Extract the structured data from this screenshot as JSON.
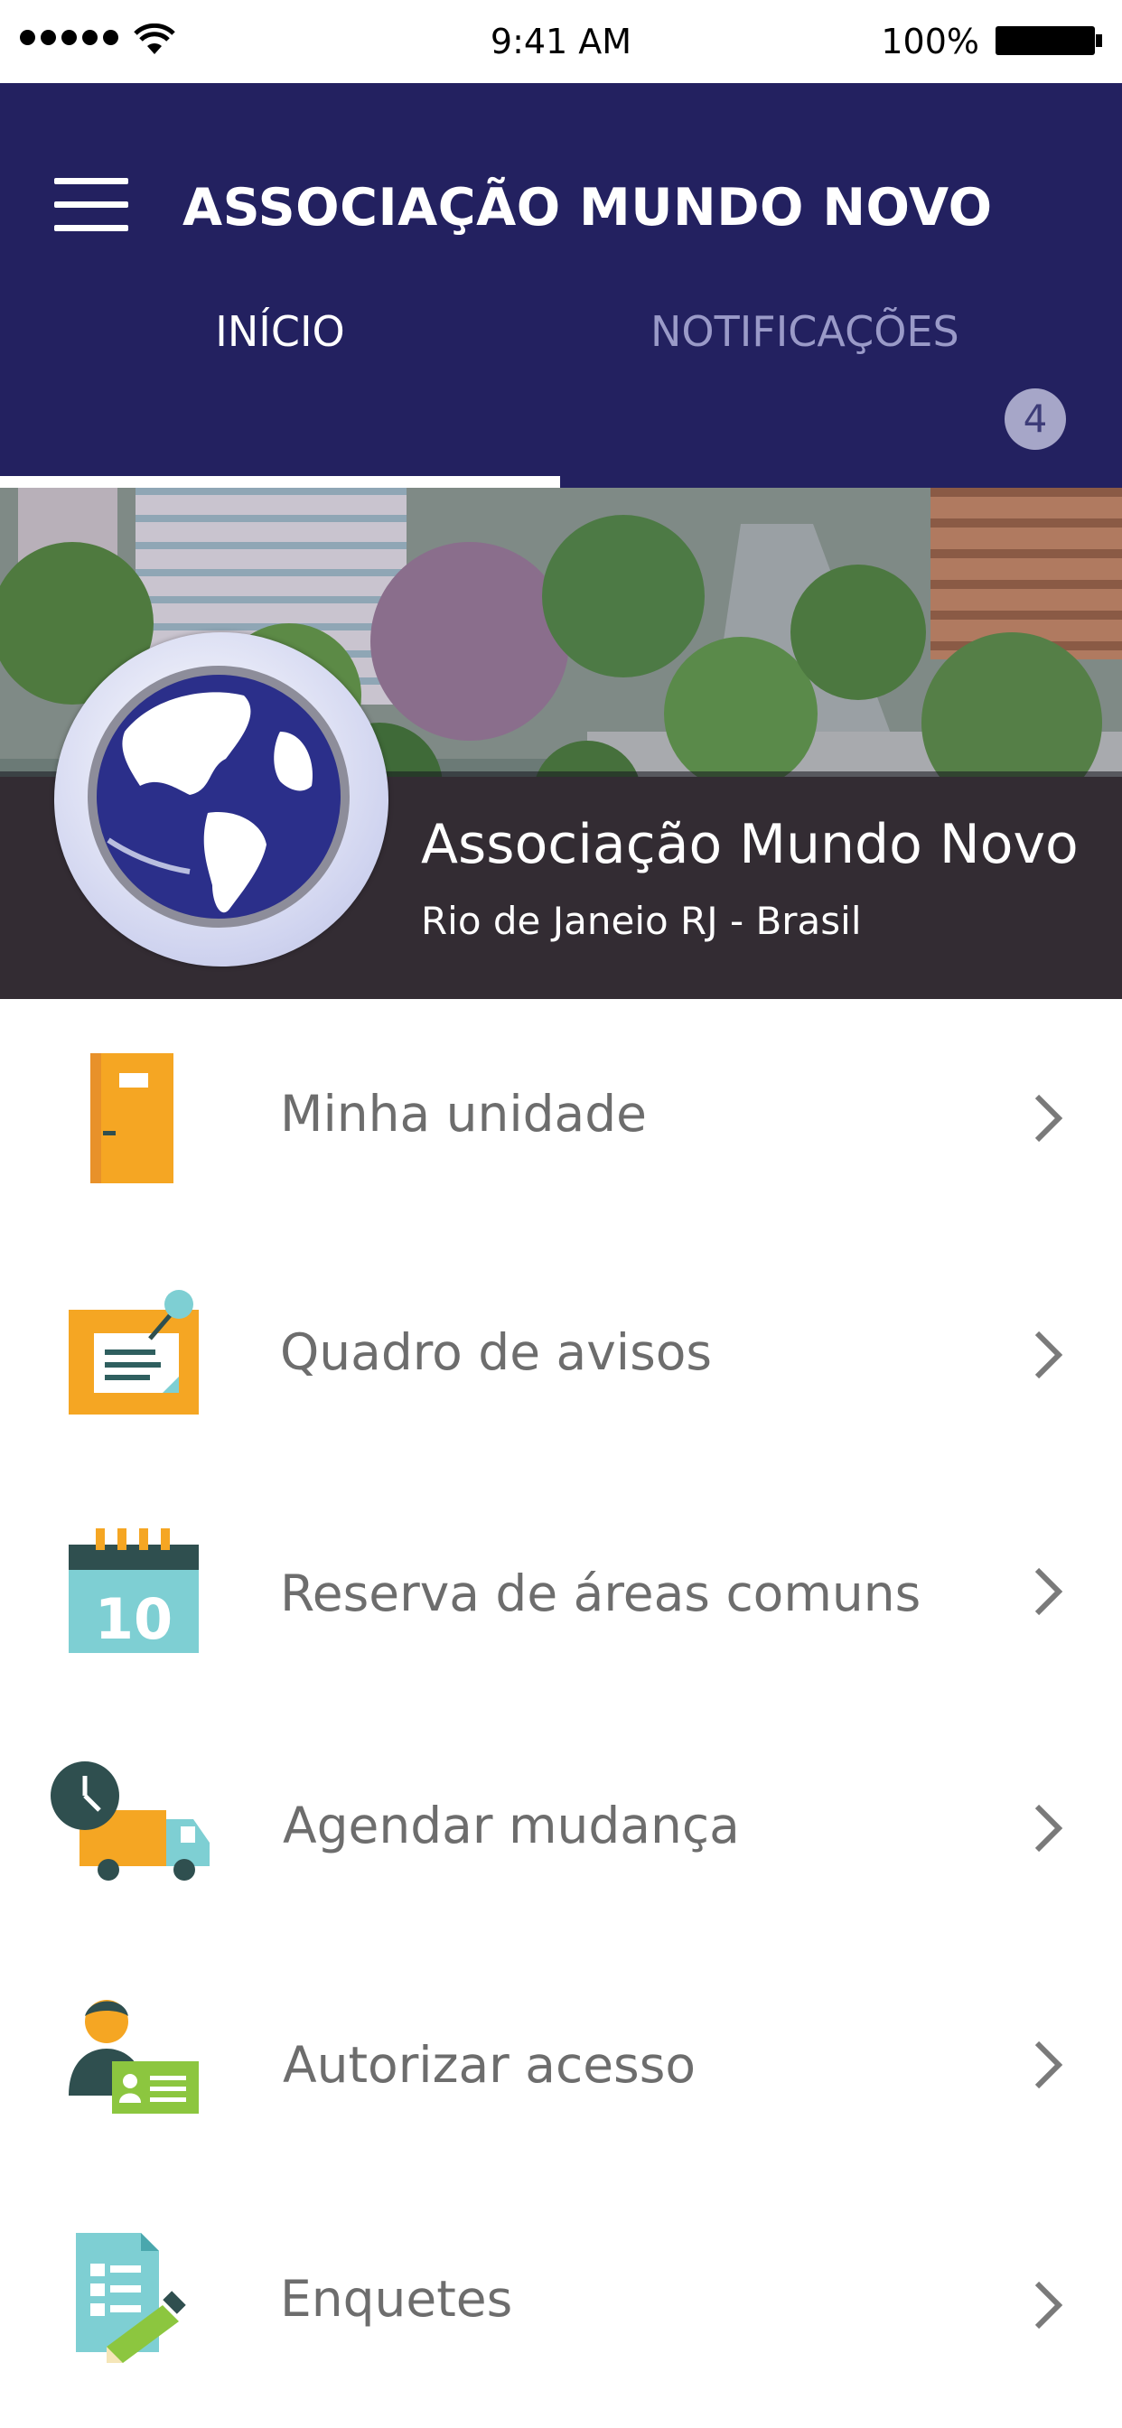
{
  "status_bar": {
    "time": "9:41 AM",
    "battery_percent": "100%"
  },
  "app_bar": {
    "title": "ASSOCIAÇÃO MUNDO NOVO",
    "menu_icon": "hamburger-menu-icon"
  },
  "tabs": [
    {
      "label": "INÍCIO",
      "selected": true
    },
    {
      "label": "NOTIFICAÇÕES",
      "badge": "4",
      "selected": false
    }
  ],
  "hero": {
    "name": "Associação Mundo Novo",
    "location": "Rio de Janeio RJ - Brasil"
  },
  "menu": [
    {
      "label": "Minha unidade",
      "icon": "door-icon"
    },
    {
      "label": "Quadro de avisos",
      "icon": "notice-board-icon"
    },
    {
      "label": "Reserva de áreas comuns",
      "icon": "calendar-icon",
      "icon_text": "10"
    },
    {
      "label": "Agendar mudança",
      "icon": "moving-truck-icon"
    },
    {
      "label": "Autorizar acesso",
      "icon": "access-id-icon"
    },
    {
      "label": "Enquetes",
      "icon": "survey-icon"
    }
  ],
  "colors": {
    "app_bar": "#232160",
    "tab_inactive": "#9a9ac8",
    "badge": "#a6a6c8",
    "menu_text": "#6d6d6d",
    "orange": "#f5a623",
    "teal": "#7ecfd3",
    "dark_teal": "#2f4f4f",
    "green": "#8cc63f"
  }
}
